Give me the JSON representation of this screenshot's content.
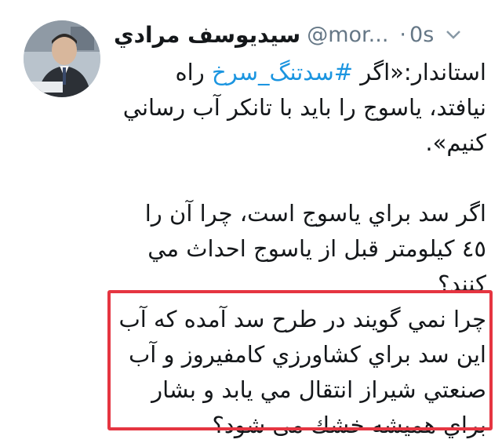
{
  "tweet": {
    "display_name": "سيديوسف مرادي",
    "handle": "@mor...",
    "separator": "·",
    "time": "0s",
    "avatar": "profile-photo",
    "paragraph1": {
      "before": "استاندار:«اگر ",
      "hashtag": "#سدتنگ_سرخ",
      "after": " راه نيافتد، ياسوج را بايد با تانكر آب رساني كنيم»."
    },
    "paragraph2": "اگر سد براي ياسوج است، چرا آن را ٤٥ كيلومتر قبل از ياسوج احداث مي كنند؟",
    "paragraph3": "چرا نمي گويند در طرح سد آمده كه آب اين سد براي كشاورزي كامفيروز و آب صنعتي شيراز انتقال مي يابد و بشار براي هميشه خشك می شود؟"
  },
  "colors": {
    "link": "#1b95e0",
    "muted": "#657786",
    "highlight_border": "#e53541",
    "text": "#14171a"
  },
  "icons": {
    "menu": "chevron-down-icon"
  }
}
